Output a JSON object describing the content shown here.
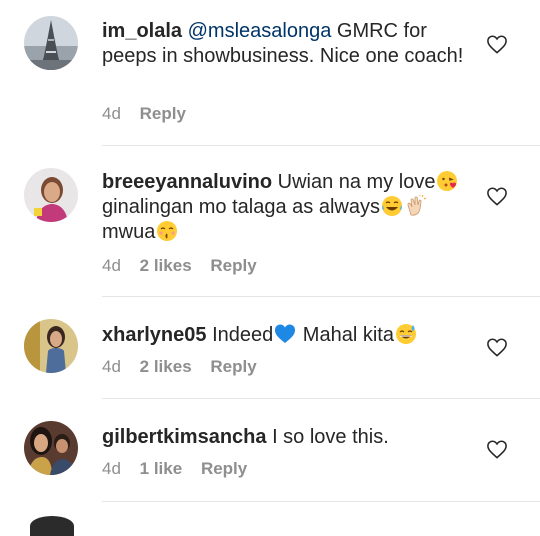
{
  "comments": [
    {
      "username": "im_olala",
      "mention": "@msleasalonga",
      "text": " GMRC for peeps in showbusiness. Nice one coach!",
      "time": "4d",
      "likes": "",
      "reply_label": "Reply",
      "avatar_icon": "eiffel-tower-photo-avatar"
    },
    {
      "username": "breeeyannaluvino",
      "text_a": " Uwian na my love",
      "text_b": " ginalingan mo talaga as always",
      "text_c": " mwua",
      "time": "4d",
      "likes": "2 likes",
      "reply_label": "Reply",
      "avatar_icon": "girl-portrait-avatar"
    },
    {
      "username": "xharlyne05",
      "text_a": " Indeed",
      "text_b": " Mahal kita",
      "time": "4d",
      "likes": "2 likes",
      "reply_label": "Reply",
      "avatar_icon": "woman-portrait-avatar"
    },
    {
      "username": "gilbertkimsancha",
      "text": " I so love this.",
      "time": "4d",
      "likes": "1 like",
      "reply_label": "Reply",
      "avatar_icon": "couple-portrait-avatar"
    }
  ],
  "icons": {
    "like": "heart-outline-icon",
    "emoji_kiss_heart": "face-blowing-kiss-emoji",
    "emoji_tears_joy": "face-with-tears-of-joy-emoji",
    "emoji_clap": "clapping-hands-emoji",
    "emoji_kiss_smile": "kissing-face-smiling-eyes-emoji",
    "emoji_blue_heart": "blue-heart-emoji",
    "emoji_sweat_smile": "grinning-face-with-sweat-emoji"
  },
  "colors": {
    "text": "#262626",
    "meta": "#8e8e8e",
    "mention": "#003569",
    "divider": "#e6e6e6"
  }
}
